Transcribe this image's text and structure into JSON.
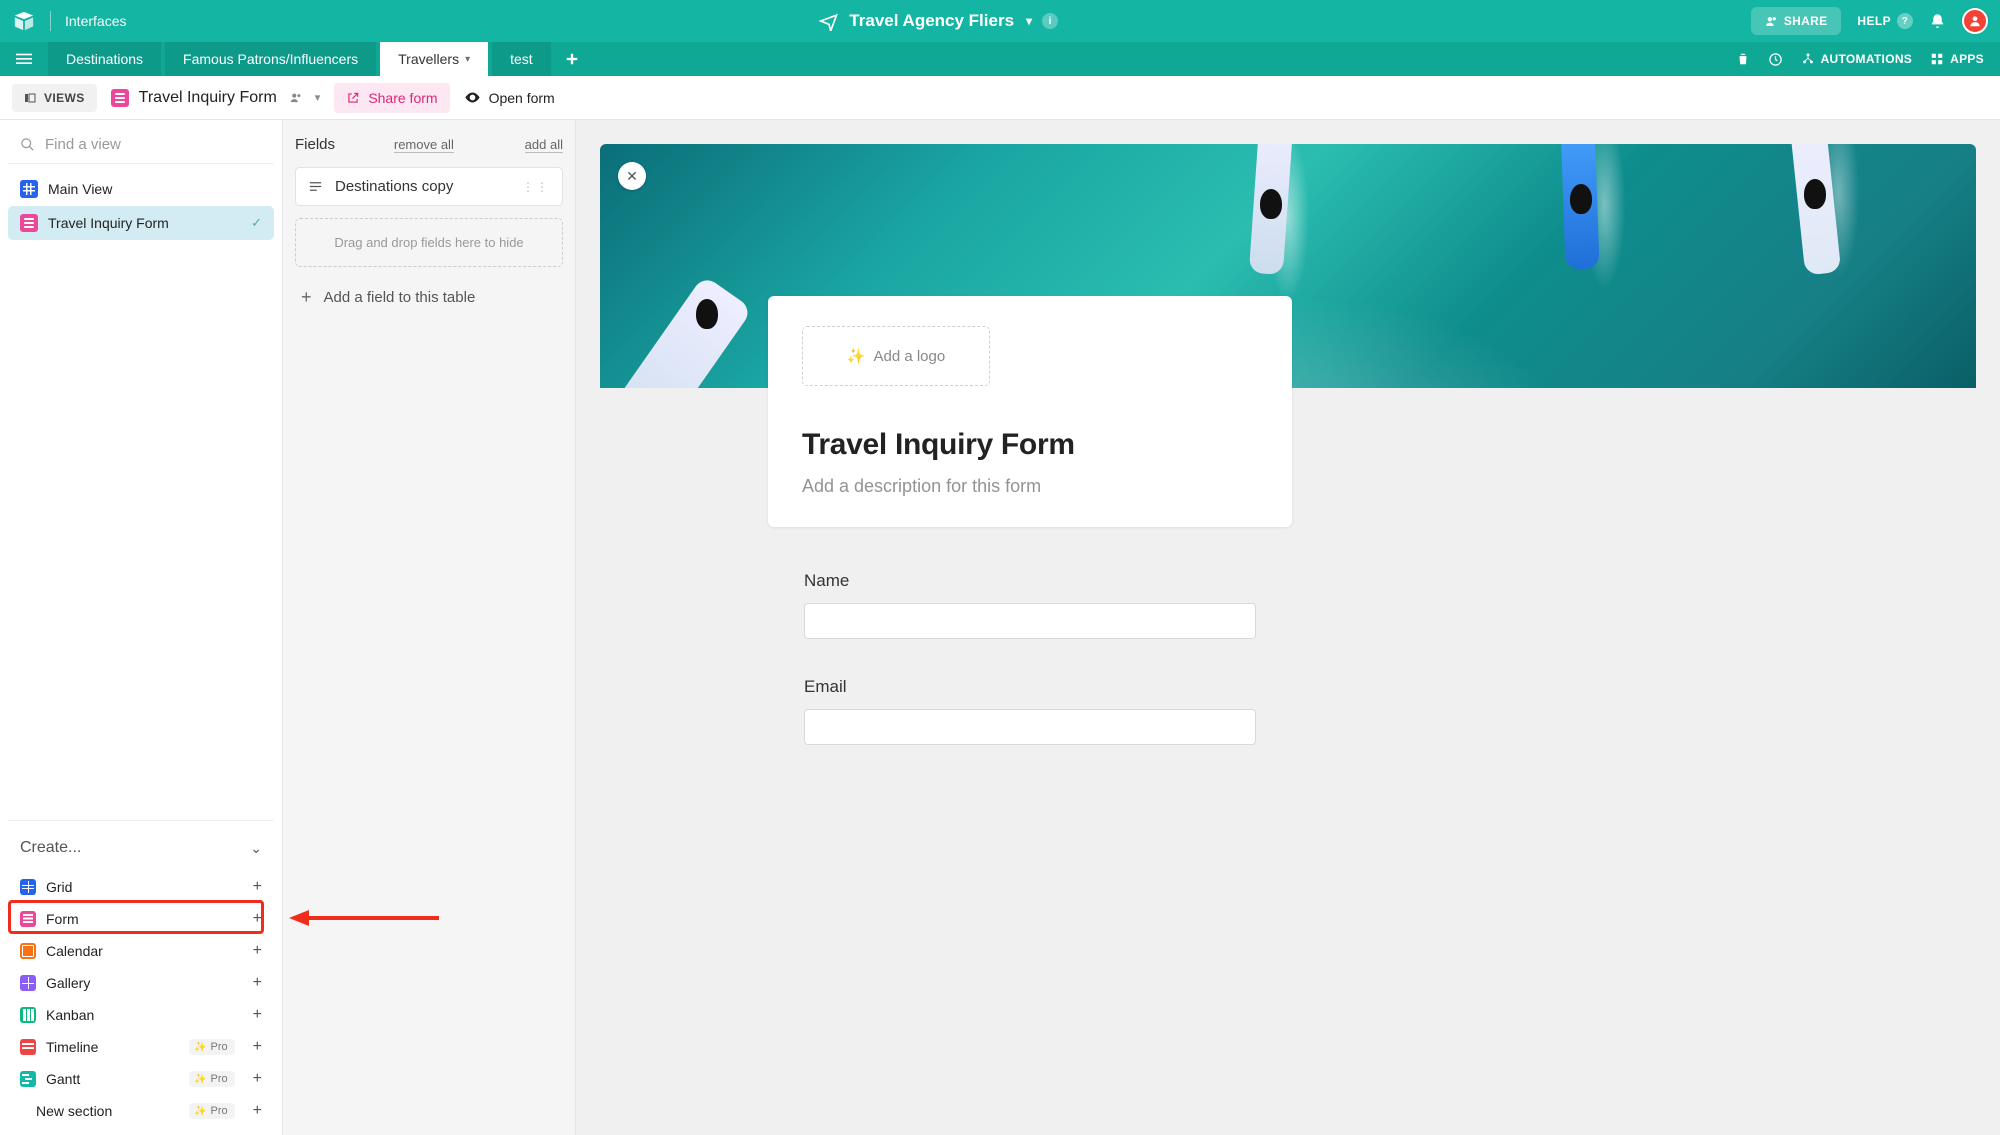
{
  "topbar": {
    "interfaces": "Interfaces",
    "base_name": "Travel Agency Fliers",
    "share": "SHARE",
    "help": "HELP",
    "automations": "AUTOMATIONS",
    "apps": "APPS"
  },
  "tabs": {
    "items": [
      {
        "label": "Destinations",
        "active": false
      },
      {
        "label": "Famous Patrons/Influencers",
        "active": false
      },
      {
        "label": "Travellers",
        "active": true
      },
      {
        "label": "test",
        "active": false
      }
    ]
  },
  "toolbar": {
    "views": "VIEWS",
    "current_view": "Travel Inquiry Form",
    "share_form": "Share form",
    "open_form": "Open form"
  },
  "sidebar": {
    "search_placeholder": "Find a view",
    "views": [
      {
        "label": "Main View",
        "type": "grid",
        "active": false
      },
      {
        "label": "Travel Inquiry Form",
        "type": "form",
        "active": true
      }
    ],
    "create_label": "Create...",
    "create_items": [
      {
        "label": "Grid",
        "icon": "grid",
        "pro": false
      },
      {
        "label": "Form",
        "icon": "form",
        "pro": false,
        "highlighted": true
      },
      {
        "label": "Calendar",
        "icon": "calendar",
        "pro": false
      },
      {
        "label": "Gallery",
        "icon": "gallery",
        "pro": false
      },
      {
        "label": "Kanban",
        "icon": "kanban",
        "pro": false
      },
      {
        "label": "Timeline",
        "icon": "timeline",
        "pro": true
      },
      {
        "label": "Gantt",
        "icon": "gantt",
        "pro": true
      },
      {
        "label": "New section",
        "icon": "",
        "pro": true
      }
    ],
    "pro_badge": "Pro"
  },
  "fields_panel": {
    "title": "Fields",
    "remove_all": "remove all",
    "add_all": "add all",
    "field_chip": "Destinations copy",
    "dropzone": "Drag and drop fields here to hide",
    "add_field": "Add a field to this table"
  },
  "form": {
    "add_logo": "Add a logo",
    "title": "Travel Inquiry Form",
    "description_placeholder": "Add a description for this form",
    "fields": [
      {
        "label": "Name"
      },
      {
        "label": "Email"
      }
    ]
  }
}
